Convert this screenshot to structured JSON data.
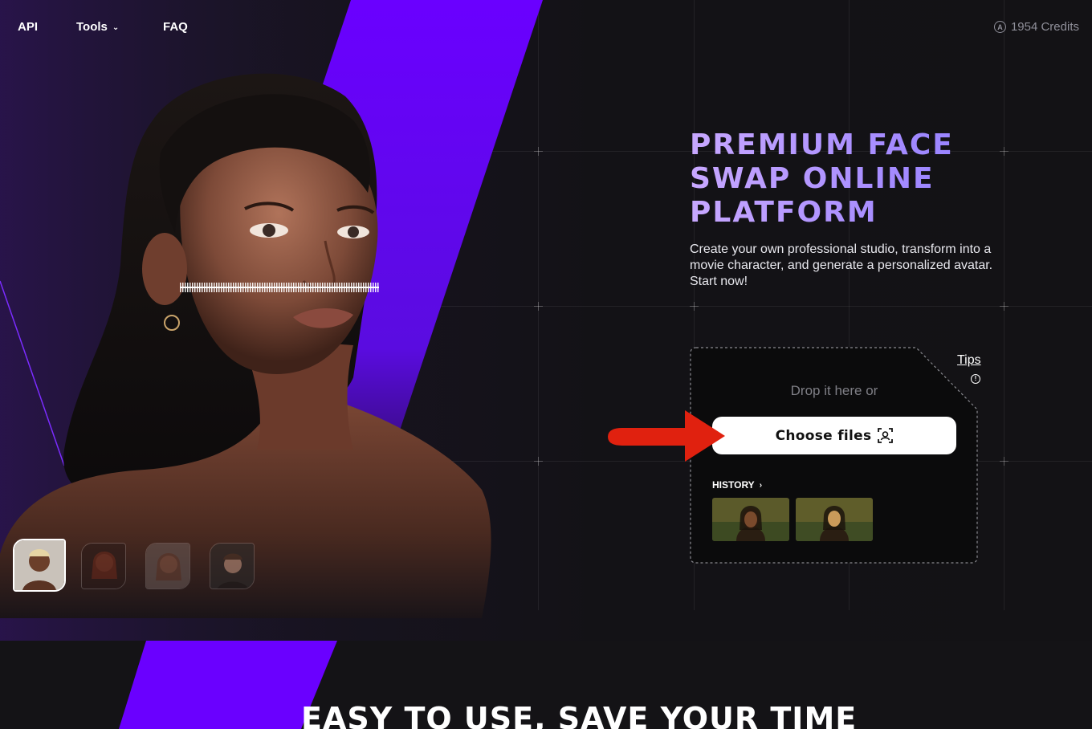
{
  "nav": {
    "api_label": "API",
    "tools_label": "Tools",
    "faq_label": "FAQ",
    "credits_text": "1954 Credits"
  },
  "hero": {
    "headline_line1": "PREMIUM FACE",
    "headline_line2": "SWAP ONLINE",
    "headline_line3": "PLATFORM",
    "subtitle": "Create your own professional studio, transform into a movie character, and generate a personalized avatar. Start now!"
  },
  "upload": {
    "tips_label": "Tips",
    "drop_text": "Drop it here or",
    "choose_label": "Choose files",
    "history_label": "HISTORY"
  },
  "section": {
    "title": "EASY TO USE, SAVE YOUR TIME"
  },
  "colors": {
    "accent_purple": "#6a00ff",
    "arrow_red": "#e0210f",
    "headline_gradient_start": "#c8a8ff"
  },
  "icons": [
    "chevron-down-icon",
    "credits-icon",
    "info-icon",
    "face-scan-icon",
    "chevron-right-icon"
  ]
}
